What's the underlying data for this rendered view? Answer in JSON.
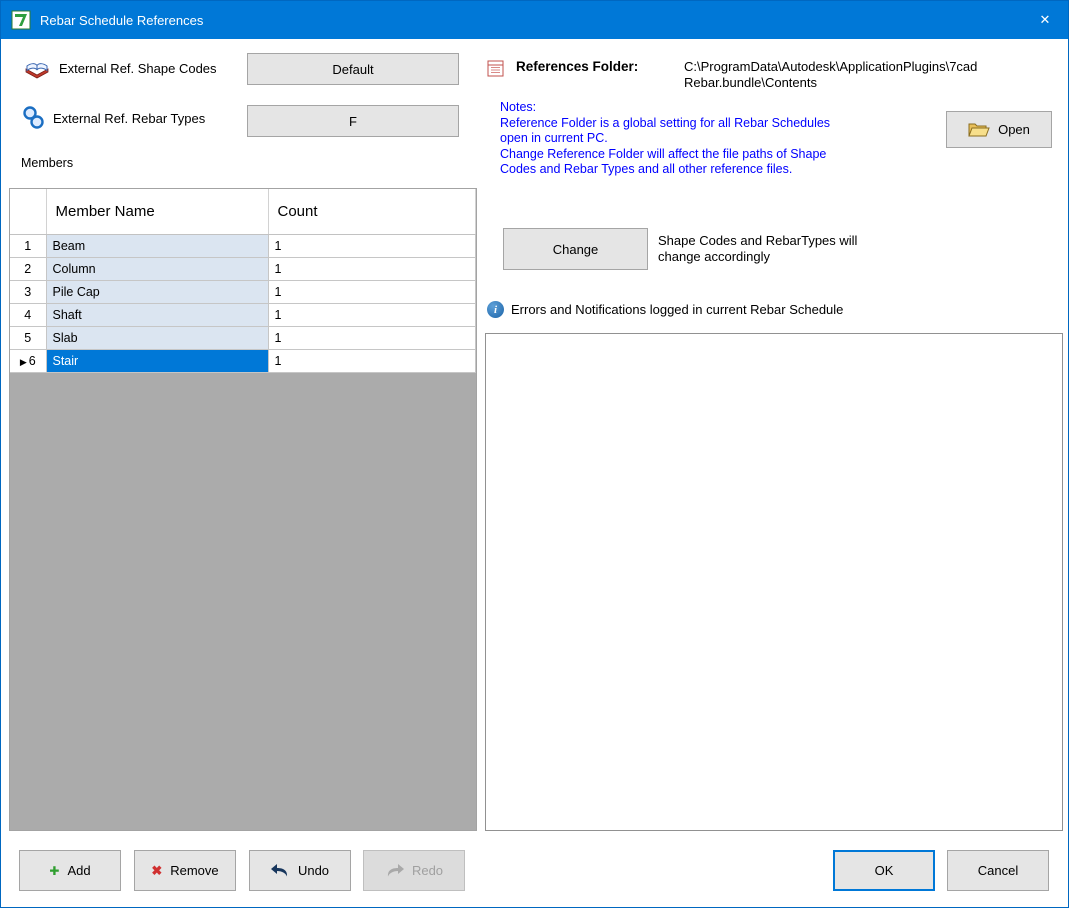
{
  "window": {
    "title": "Rebar Schedule References"
  },
  "colors": {
    "accent": "#0078d7",
    "selection": "#0078d7",
    "row_tint": "#dbe5f1",
    "notes_text": "#0000ff",
    "grid_empty": "#ababab"
  },
  "icons": {
    "app": "app-icon",
    "close": "✕",
    "add": "✚",
    "remove": "✖",
    "info": "i",
    "row_marker": "▶"
  },
  "left_panel": {
    "shape_codes_label": "External Ref. Shape Codes",
    "shape_codes_button": "Default",
    "rebar_types_label": "External Ref. Rebar Types",
    "rebar_types_button": "F",
    "members_label": "Members"
  },
  "grid": {
    "columns": [
      "Member Name",
      "Count"
    ],
    "rows": [
      {
        "num": "1",
        "name": "Beam",
        "count": "1",
        "selected": false
      },
      {
        "num": "2",
        "name": "Column",
        "count": "1",
        "selected": false
      },
      {
        "num": "3",
        "name": "Pile Cap",
        "count": "1",
        "selected": false
      },
      {
        "num": "4",
        "name": "Shaft",
        "count": "1",
        "selected": false
      },
      {
        "num": "5",
        "name": "Slab",
        "count": "1",
        "selected": false
      },
      {
        "num": "6",
        "name": "Stair",
        "count": "1",
        "selected": true
      }
    ]
  },
  "right_panel": {
    "references_folder_label": "References Folder:",
    "references_folder_value": "C:\\ProgramData\\Autodesk\\ApplicationPlugins\\7cad\nRebar.bundle\\Contents",
    "notes": "Notes:\nReference Folder is a global setting for all Rebar Schedules\nopen in current PC.\nChange Reference Folder will affect the file paths of Shape\nCodes and Rebar Types and all other reference files.",
    "open_button": "Open",
    "change_button": "Change",
    "change_note": "Shape Codes and RebarTypes will\nchange accordingly",
    "errors_label": "Errors and Notifications logged in current Rebar Schedule"
  },
  "footer": {
    "add_label": "Add",
    "remove_label": "Remove",
    "undo_label": "Undo",
    "redo_label": "Redo",
    "ok_label": "OK",
    "cancel_label": "Cancel"
  }
}
